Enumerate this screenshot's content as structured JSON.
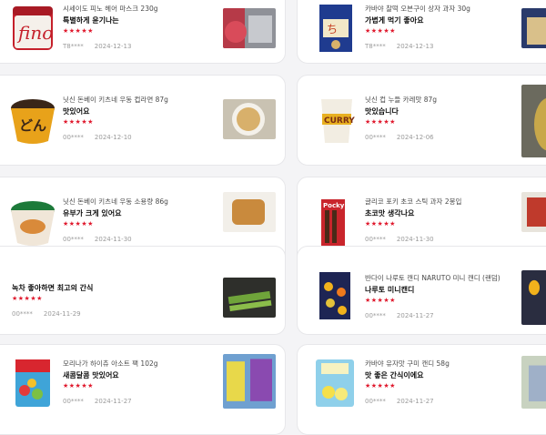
{
  "reviews": [
    {
      "title": "시세이도 피노 헤어 마스크 230g",
      "review": "특별하게 윤기나는",
      "stars": "★★★★★",
      "user": "T8****",
      "date": "2024-12-13"
    },
    {
      "title": "카바야 찰떡 오븐구이 상자 과자 30g",
      "review": "가볍게 먹기 좋아요",
      "stars": "★★★★★",
      "user": "T8****",
      "date": "2024-12-13"
    },
    {
      "title": "닛신 돈베이 키츠네 우동 컵라면 87g",
      "review": "맛있어요",
      "stars": "★★★★★",
      "user": "00****",
      "date": "2024-12-10"
    },
    {
      "title": "닛신 컵 누들 카레맛 87g",
      "review": "맛있습니다",
      "stars": "★★★★★",
      "user": "00****",
      "date": "2024-12-06"
    },
    {
      "title": "닛신 돈베이 키츠네 우동 소용량 86g",
      "review": "유부가 크게 있어요",
      "stars": "★★★★★",
      "user": "00****",
      "date": "2024-11-30"
    },
    {
      "title": "글리코 포키 초코 스틱 과자 2봉입",
      "review": "초코맛 생각나요",
      "stars": "★★★★★",
      "user": "00****",
      "date": "2024-11-30"
    },
    {
      "title": "",
      "review": "녹차 좋아하면 최고의 간식",
      "stars": "★★★★★",
      "user": "00****",
      "date": "2024-11-29"
    },
    {
      "title": "반다이 나루토 캔디 NARUTO 미니 캔디 (랜덤)",
      "review": "나루토 미니캔디",
      "stars": "★★★★★",
      "user": "00****",
      "date": "2024-11-27"
    },
    {
      "title": "모리나가 하이츄 아소트 팩 102g",
      "review": "새콤달콤 맛있어요",
      "stars": "★★★★★",
      "user": "00****",
      "date": "2024-11-27"
    },
    {
      "title": "카바야 유자맛 구미 캔디 58g",
      "review": "맛 좋은 간식이에요",
      "stars": "★★★★★",
      "user": "00****",
      "date": "2024-11-27"
    }
  ],
  "colors": {
    "star": "#e0192d",
    "background": "#f4f4f6",
    "card": "#ffffff"
  }
}
